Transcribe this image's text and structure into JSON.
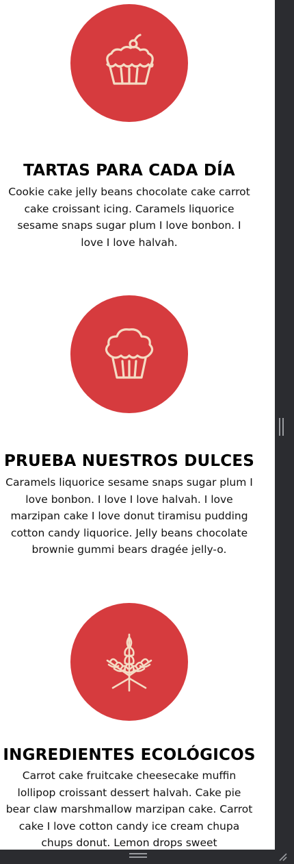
{
  "colors": {
    "accent": "#d63b3e",
    "icon_stroke": "#f4dcc4",
    "frame": "#2b2c30"
  },
  "features": [
    {
      "icon": "pie-icon",
      "title": "TARTAS PARA CADA DÍA",
      "description": "Cookie cake jelly beans chocolate cake carrot cake croissant icing. Caramels liquorice sesame snaps sugar plum I love bonbon. I love I love halvah."
    },
    {
      "icon": "cupcake-icon",
      "title": "PRUEBA NUESTROS DULCES",
      "description": "Caramels liquorice sesame snaps sugar plum I love bonbon. I love I love halvah. I love marzipan cake I love donut tiramisu pudding cotton candy liquorice. Jelly beans chocolate brownie gummi bears dragée jelly-o."
    },
    {
      "icon": "wheat-icon",
      "title": "INGREDIENTES ECOLÓGICOS",
      "description": "Carrot cake fruitcake cheesecake muffin lollipop croissant dessert halvah. Cake pie bear claw marshmallow marzipan cake. Carrot cake I love cotton candy ice cream chupa chups donut. Lemon drops sweet marshmallow"
    }
  ]
}
